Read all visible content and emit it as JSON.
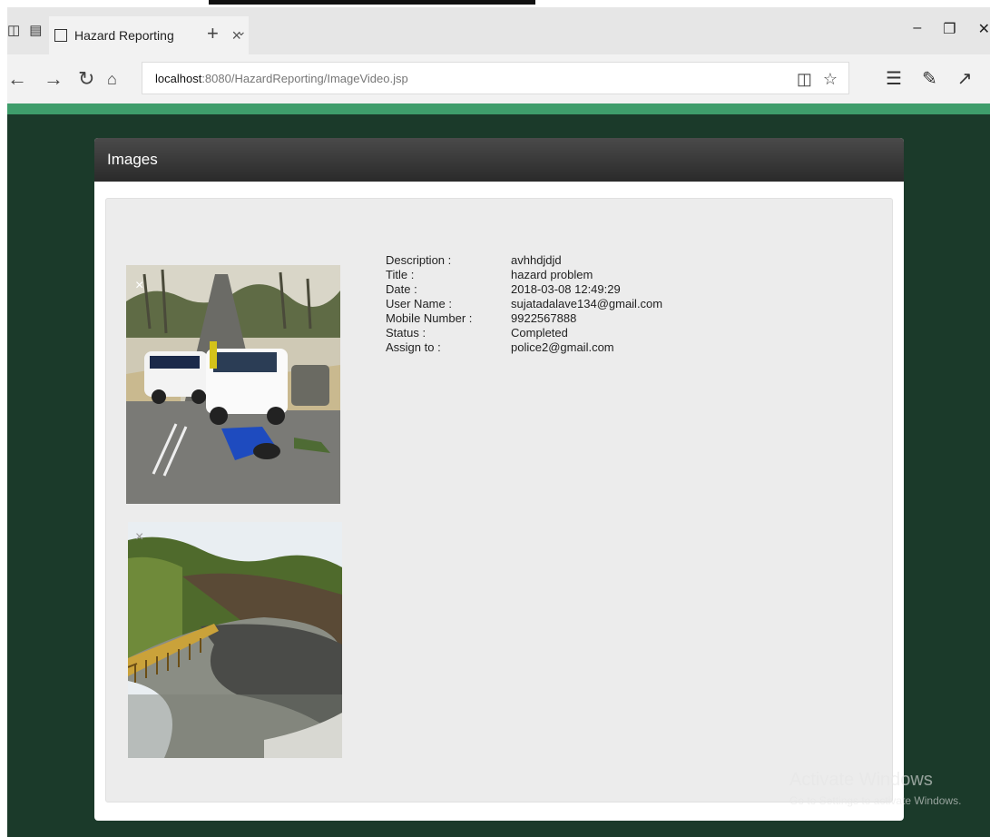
{
  "browser": {
    "tab_title": "Hazard Reporting",
    "url_host": "localhost",
    "url_path": ":8080/HazardReporting/ImageVideo.jsp"
  },
  "panel": {
    "title": "Images"
  },
  "details": [
    {
      "label": "Description :",
      "value": "avhhdjdjd"
    },
    {
      "label": "Title :",
      "value": "hazard problem"
    },
    {
      "label": "Date :",
      "value": "2018-03-08 12:49:29"
    },
    {
      "label": "User Name :",
      "value": "sujatadalave134@gmail.com"
    },
    {
      "label": "Mobile Number :",
      "value": "9922567888"
    },
    {
      "label": "Status :",
      "value": "Completed"
    },
    {
      "label": "Assign to :",
      "value": "police2@gmail.com"
    }
  ],
  "watermark": {
    "line1": "Activate Windows",
    "line2": "Go to Settings to activate Windows."
  },
  "colors": {
    "page_bg": "#1b3a2a",
    "accent_green": "#3f9d6b",
    "panel_header": "#2f2f2f"
  }
}
